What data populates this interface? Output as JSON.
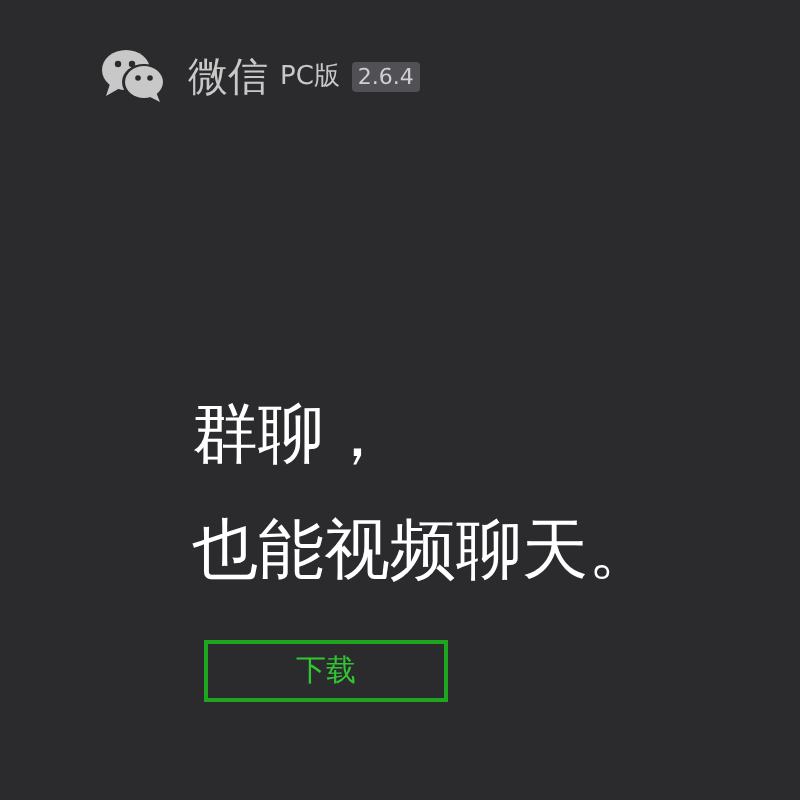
{
  "header": {
    "app_name": "微信",
    "edition": "PC版",
    "version": "2.6.4"
  },
  "headline": [
    "群聊，",
    "也能视频聊天。"
  ],
  "download_button": {
    "label": "下载"
  }
}
